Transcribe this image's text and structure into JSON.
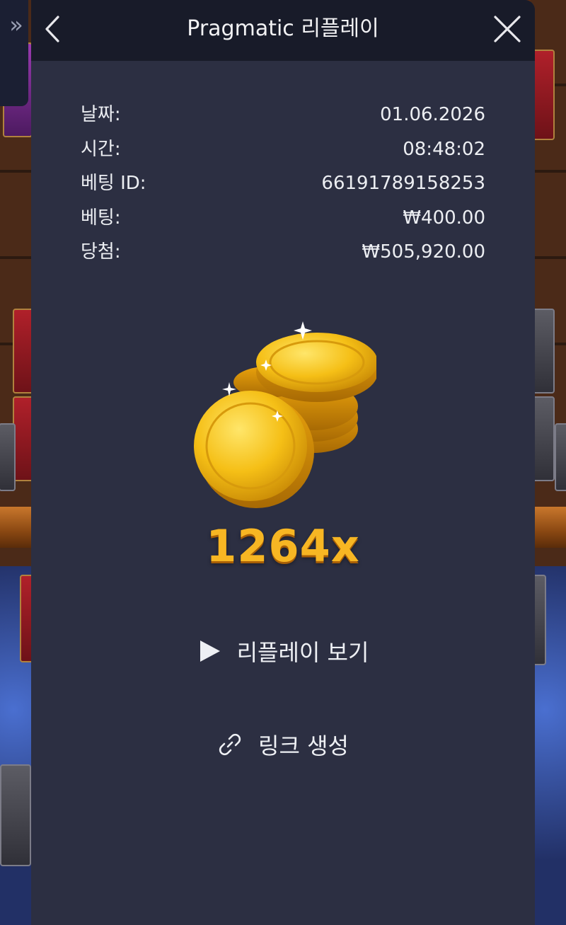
{
  "header": {
    "title": "Pragmatic 리플레이",
    "back_icon": "chevron-left-icon",
    "close_icon": "close-icon"
  },
  "sidebar_toggle": {
    "icon": "double-chevron-right-icon",
    "glyph": "»"
  },
  "bet_info": [
    {
      "label": "날짜:",
      "value": "01.06.2026"
    },
    {
      "label": "시간:",
      "value": "08:48:02"
    },
    {
      "label": "베팅 ID:",
      "value": "66191789158253"
    },
    {
      "label": "베팅:",
      "value": "₩400.00"
    },
    {
      "label": "당첨:",
      "value": "₩505,920.00"
    }
  ],
  "win": {
    "multiplier": "1264x",
    "icon": "gold-coins-icon"
  },
  "actions": {
    "replay_label": "리플레이 보기",
    "replay_icon": "play-icon",
    "link_label": "링크 생성",
    "link_icon": "link-icon"
  },
  "colors": {
    "modal_bg": "#2c2f42",
    "header_bg": "#181b29",
    "multiplier": "#f7b623"
  }
}
